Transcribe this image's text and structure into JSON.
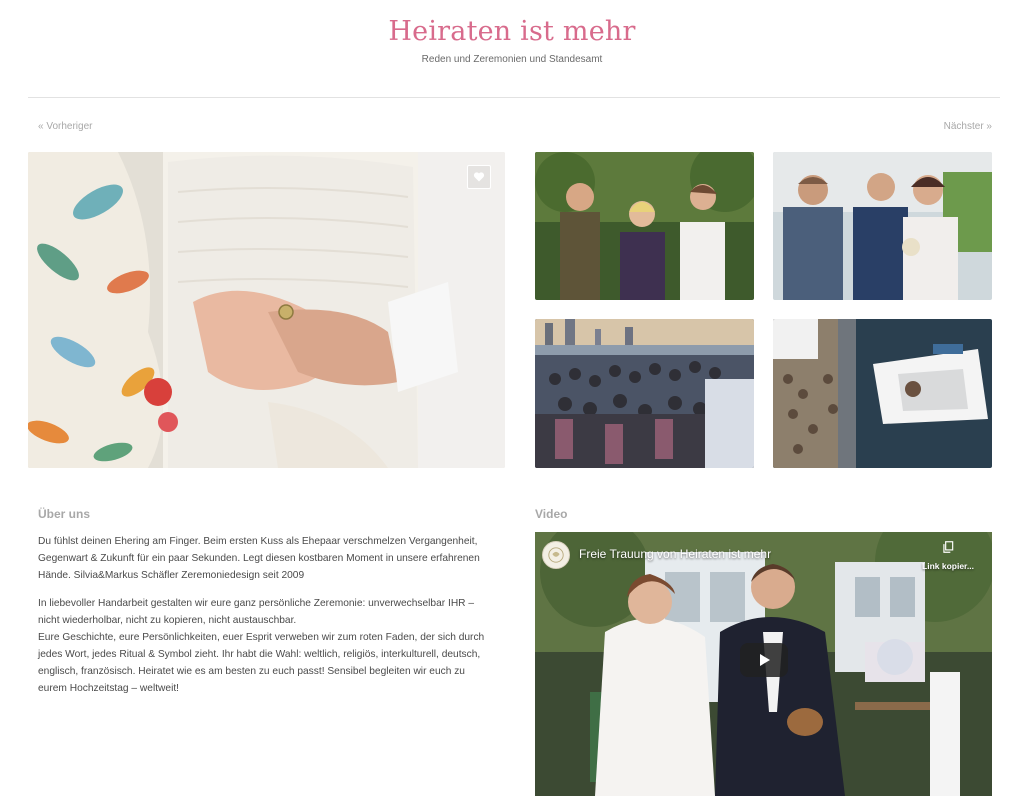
{
  "site": {
    "title": "Heiraten ist mehr",
    "tagline": "Reden und Zeremonien und Standesamt"
  },
  "navigation": {
    "previous": "« Vorheriger",
    "next": "Nächster »"
  },
  "gallery": {
    "main_photo": "hands-ring-icon",
    "favorite_icon": "heart-icon",
    "thumbnails": [
      "ceremony-outdoor-photo",
      "couple-officiant-photo",
      "boat-party-photo",
      "boat-aerial-photo"
    ]
  },
  "about": {
    "title": "Über uns",
    "paragraphs": [
      [
        "Du fühlst deinen Ehering am Finger. Beim ersten Kuss als Ehepaar verschmelzen Vergangenheit,",
        "Gegenwart & Zukunft für ein paar Sekunden. Legt diesen kostbaren Moment in unsere erfahrenen",
        "Hände. Silvia&Markus Schäfler Zeremoniedesign seit 2009"
      ],
      [
        "In liebevoller Handarbeit gestalten wir eure ganz persönliche Zeremonie: unverwechselbar IHR –",
        "nicht wiederholbar, nicht zu kopieren, nicht austauschbar.",
        "Eure Geschichte, eure Persönlichkeiten, euer Esprit verweben wir zum roten Faden, der sich durch",
        "jedes Wort, jedes Ritual & Symbol zieht. Ihr habt die Wahl: weltlich, religiös, interkulturell, deutsch,",
        "englisch, französisch. Heiratet wie es am besten zu euch passt! Sensibel begleiten wir euch zu",
        "eurem Hochzeitstag – weltweit!"
      ]
    ]
  },
  "video": {
    "section_title": "Video",
    "title": "Freie Trauung von Heiraten ist mehr",
    "copy_link_label": "Link kopier...",
    "icons": {
      "copy": "copy-icon",
      "play": "play-icon",
      "channel": "channel-avatar-icon"
    }
  },
  "colors": {
    "brand_pink": "#d86b8c",
    "muted_gray": "#a8a8a8",
    "text": "#4a4a4a"
  }
}
